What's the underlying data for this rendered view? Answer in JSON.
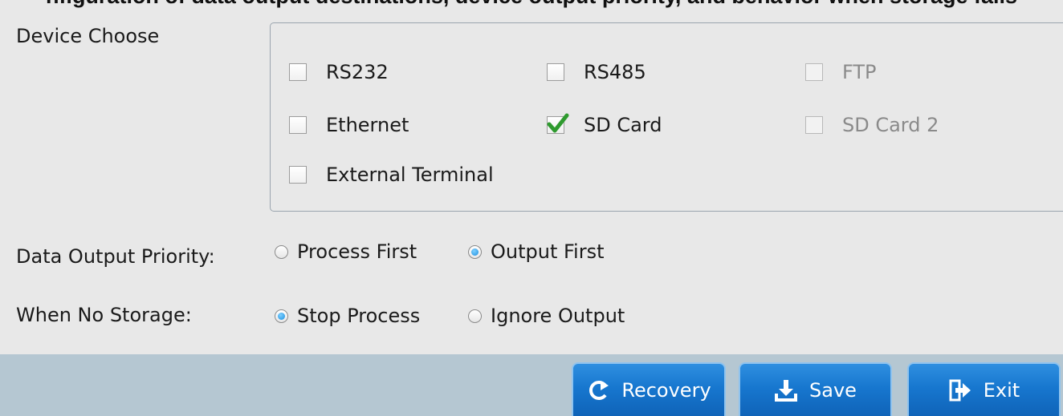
{
  "top_text": "nfiguration of data output destinations, device output priority, and behavior when storage fails",
  "device_choose": {
    "label": "Device Choose",
    "options": [
      {
        "label": "RS232",
        "checked": false,
        "disabled": false
      },
      {
        "label": "RS485",
        "checked": false,
        "disabled": false
      },
      {
        "label": "FTP",
        "checked": false,
        "disabled": true
      },
      {
        "label": "Ethernet",
        "checked": false,
        "disabled": false
      },
      {
        "label": "SD Card",
        "checked": true,
        "disabled": false
      },
      {
        "label": "SD Card 2",
        "checked": false,
        "disabled": true
      },
      {
        "label": "External Terminal",
        "checked": false,
        "disabled": false
      }
    ]
  },
  "priority": {
    "label": "Data Output Priority:",
    "options": [
      {
        "label": "Process First",
        "selected": false
      },
      {
        "label": "Output First",
        "selected": true
      }
    ]
  },
  "no_storage": {
    "label": "When No Storage:",
    "options": [
      {
        "label": "Stop Process",
        "selected": true
      },
      {
        "label": "Ignore Output",
        "selected": false
      }
    ]
  },
  "buttons": {
    "recovery": "Recovery",
    "save": "Save",
    "exit": "Exit"
  },
  "colors": {
    "footer": "#b5c7d2",
    "button": "#1777cf",
    "check": "#2e9a2e",
    "radio_on": "#1a8fe0"
  }
}
